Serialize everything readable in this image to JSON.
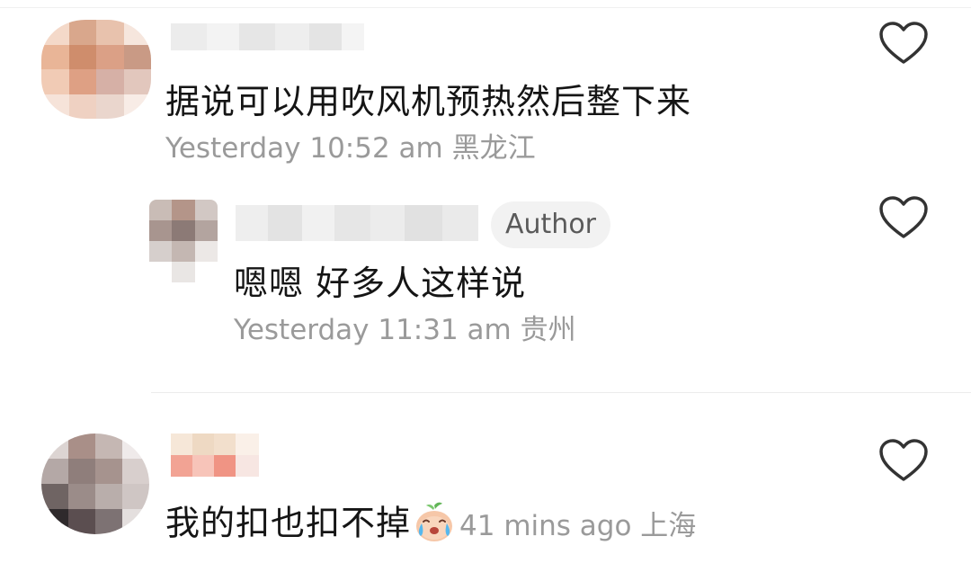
{
  "comments": [
    {
      "text": "据说可以用吹风机预热然后整下来",
      "time": "Yesterday 10:52 am",
      "location": "黑龙江"
    },
    {
      "badge": "Author",
      "text": "嗯嗯 好多人这样说",
      "time": "Yesterday 11:31 am",
      "location": "贵州"
    },
    {
      "text": "我的扣也扣不掉",
      "time": "41 mins ago",
      "location": "上海",
      "emoji": "crying-face-emoji"
    }
  ],
  "icons": {
    "like": "heart-outline-icon"
  },
  "colors": {
    "text_primary": "#151515",
    "text_meta": "#9a9a9a",
    "badge_bg": "#f2f2f2",
    "badge_text": "#5a5a5a",
    "icon_stroke": "#333333"
  }
}
